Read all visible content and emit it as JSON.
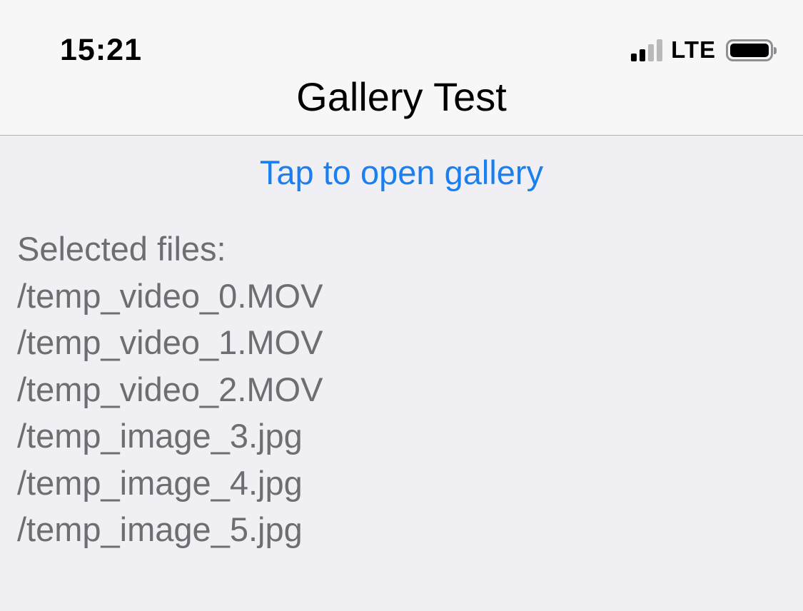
{
  "status_bar": {
    "time": "15:21",
    "network": "LTE",
    "signal_bars_filled": 2,
    "signal_bars_total": 4,
    "battery_level": 0.9
  },
  "nav": {
    "title": "Gallery Test"
  },
  "main": {
    "open_gallery_label": "Tap to open gallery",
    "selected_label": "Selected files:",
    "files": [
      "/temp_video_0.MOV",
      "/temp_video_1.MOV",
      "/temp_video_2.MOV",
      "/temp_image_3.jpg",
      "/temp_image_4.jpg",
      "/temp_image_5.jpg"
    ]
  },
  "colors": {
    "accent": "#1a7ff0",
    "secondary_text": "#6d6d72",
    "background": "#efeff4",
    "header": "#f7f7f7"
  }
}
